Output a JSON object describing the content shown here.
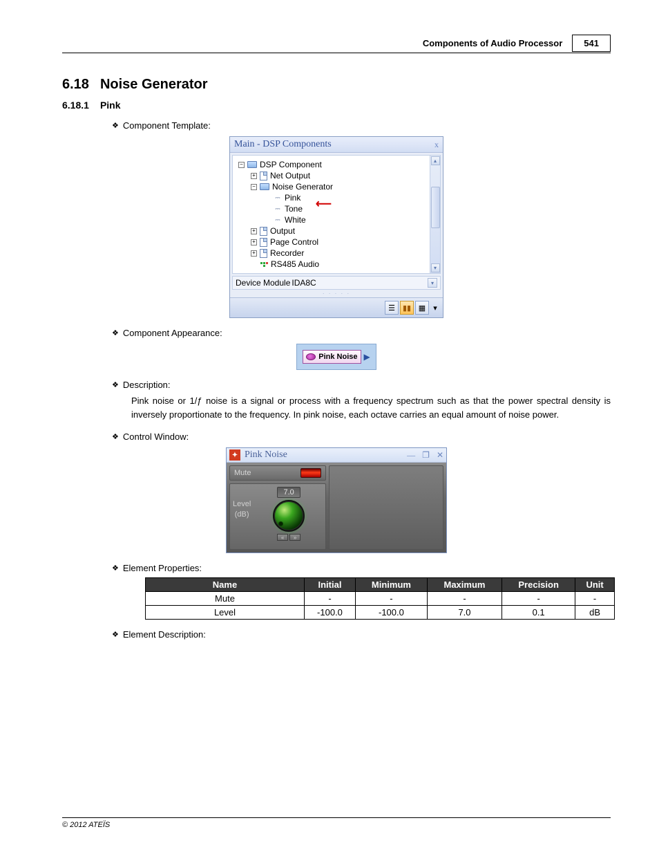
{
  "header": {
    "title": "Components of Audio Processor",
    "page": "541"
  },
  "h1": {
    "num": "6.18",
    "title": "Noise Generator"
  },
  "h2": {
    "num": "6.18.1",
    "title": "Pink"
  },
  "bullets": {
    "template": "Component Template:",
    "appearance": "Component Appearance:",
    "description": "Description:",
    "control": "Control Window:",
    "elprops": "Element Properties:",
    "eldesc": "Element Description:"
  },
  "dsp": {
    "title": "Main - DSP Components",
    "close": "x",
    "tree": {
      "root": "DSP Component",
      "net_output": "Net Output",
      "noise_gen": "Noise Generator",
      "pink": "Pink",
      "tone": "Tone",
      "white": "White",
      "output": "Output",
      "page_control": "Page Control",
      "recorder": "Recorder",
      "rs485": "RS485 Audio"
    },
    "device_label": "Device Module",
    "device_value": "IDA8C",
    "scroll": {
      "up": "▴",
      "down": "▾",
      "mid": "≡"
    }
  },
  "chip": {
    "label": "Pink Noise",
    "port": "▶"
  },
  "description_text": "Pink noise or 1/ƒ noise is a signal or process with a frequency spectrum such as that the power spectral density is inversely proportionate to the frequency. In pink noise, each octave carries an equal amount of noise power.",
  "ctrlwin": {
    "title": "Pink Noise",
    "mute": "Mute",
    "level_label1": "Level",
    "level_label2": "(dB)",
    "level_value": "7.0",
    "min": "−",
    "max": "＋",
    "wmin": "—",
    "wrestore": "❐",
    "wclose": "✕"
  },
  "table": {
    "headers": {
      "name": "Name",
      "initial": "Initial",
      "min": "Minimum",
      "max": "Maximum",
      "prec": "Precision",
      "unit": "Unit"
    },
    "rows": [
      {
        "name": "Mute",
        "initial": "-",
        "min": "-",
        "max": "-",
        "prec": "-",
        "unit": "-"
      },
      {
        "name": "Level",
        "initial": "-100.0",
        "min": "-100.0",
        "max": "7.0",
        "prec": "0.1",
        "unit": "dB"
      }
    ]
  },
  "footer": "© 2012 ATEÏS"
}
